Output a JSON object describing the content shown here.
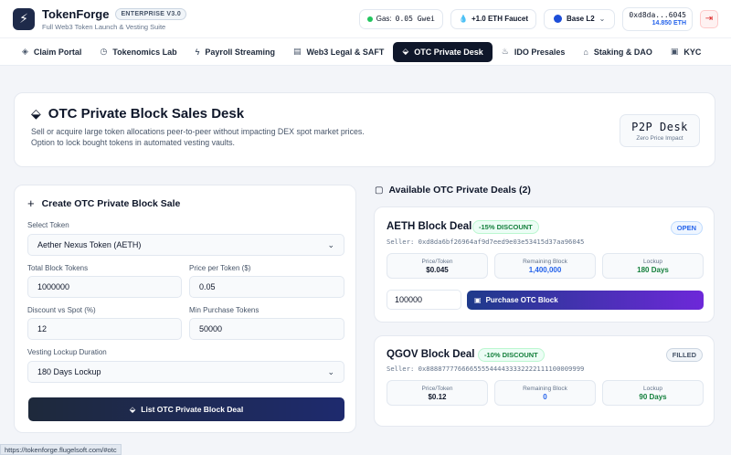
{
  "header": {
    "brand_name": "TokenForge",
    "version_badge": "ENTERPRISE V3.0",
    "subtitle": "Full Web3 Token Launch & Vesting Suite",
    "gas_label": "Gas:",
    "gas_value": "0.05 Gwei",
    "faucet_label": "+1.0 ETH Faucet",
    "network": "Base L2",
    "wallet_address": "0xd8da...6045",
    "wallet_balance": "14.850 ETH"
  },
  "nav": {
    "tabs": [
      {
        "label": "Claim Portal",
        "icon": "layers-icon",
        "active": false
      },
      {
        "label": "Tokenomics Lab",
        "icon": "clock-icon",
        "active": false
      },
      {
        "label": "Payroll Streaming",
        "icon": "bolt-icon",
        "active": false
      },
      {
        "label": "Web3 Legal & SAFT",
        "icon": "document-icon",
        "active": false
      },
      {
        "label": "OTC Private Desk",
        "icon": "tag-icon",
        "active": true
      },
      {
        "label": "IDO Presales",
        "icon": "flame-icon",
        "active": false
      },
      {
        "label": "Staking & DAO",
        "icon": "bank-icon",
        "active": false
      },
      {
        "label": "KYC",
        "icon": "id-icon",
        "active": false
      }
    ]
  },
  "hero": {
    "title": "OTC Private Block Sales Desk",
    "description": "Sell or acquire large token allocations peer-to-peer without impacting DEX spot market prices. Option to lock bought tokens in automated vesting vaults.",
    "badge_title": "P2P Desk",
    "badge_sub": "Zero Price Impact"
  },
  "create_form": {
    "title": "Create OTC Private Block Sale",
    "select_token_label": "Select Token",
    "select_token_value": "Aether Nexus Token (AETH)",
    "total_tokens_label": "Total Block Tokens",
    "total_tokens_value": "1000000",
    "price_label": "Price per Token ($)",
    "price_value": "0.05",
    "discount_label": "Discount vs Spot (%)",
    "discount_value": "12",
    "min_purchase_label": "Min Purchase Tokens",
    "min_purchase_value": "50000",
    "lockup_label": "Vesting Lockup Duration",
    "lockup_value": "180 Days Lockup",
    "submit_label": "List OTC Private Block Deal"
  },
  "deals": {
    "title": "Available OTC Private Deals (2)",
    "items": [
      {
        "name": "AETH Block Deal",
        "discount": "-15% DISCOUNT",
        "status": "OPEN",
        "seller": "Seller: 0xd8da6bf26964af9d7eed9e03e53415d37aa96045",
        "price_label": "Price/Token",
        "price": "$0.045",
        "remaining_label": "Remaining Block",
        "remaining": "1,400,000",
        "lockup_label": "Lockup",
        "lockup": "180 Days",
        "qty_value": "100000",
        "buy_label": "Purchase OTC Block"
      },
      {
        "name": "QGOV Block Deal",
        "discount": "-10% DISCOUNT",
        "status": "FILLED",
        "seller": "Seller: 0x8888777766665555444433332222111100009999",
        "price_label": "Price/Token",
        "price": "$0.12",
        "remaining_label": "Remaining Block",
        "remaining": "0",
        "lockup_label": "Lockup",
        "lockup": "90 Days"
      }
    ]
  },
  "status_bar": {
    "url": "https://tokenforge.flugelsoft.com/#otc"
  }
}
